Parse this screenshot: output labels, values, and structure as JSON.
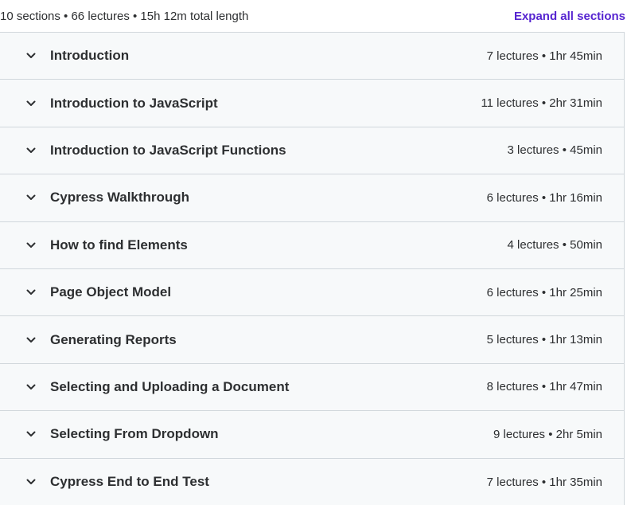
{
  "header": {
    "summary": "10 sections • 66 lectures • 15h 12m total length",
    "expand_label": "Expand all sections"
  },
  "colors": {
    "accent": "#5624d0",
    "section_bg": "#f7f9fa",
    "border": "#d1d7dc",
    "text": "#2d2f31"
  },
  "sections": [
    {
      "title": "Introduction",
      "meta": "7 lectures • 1hr 45min",
      "icon": "chevron-down-icon"
    },
    {
      "title": "Introduction to JavaScript",
      "meta": "11 lectures • 2hr 31min",
      "icon": "chevron-down-icon"
    },
    {
      "title": "Introduction to JavaScript Functions",
      "meta": "3 lectures • 45min",
      "icon": "chevron-down-icon"
    },
    {
      "title": "Cypress Walkthrough",
      "meta": "6 lectures • 1hr 16min",
      "icon": "chevron-down-icon"
    },
    {
      "title": "How to find Elements",
      "meta": "4 lectures • 50min",
      "icon": "chevron-down-icon"
    },
    {
      "title": "Page Object Model",
      "meta": "6 lectures • 1hr 25min",
      "icon": "chevron-down-icon"
    },
    {
      "title": "Generating Reports",
      "meta": "5 lectures • 1hr 13min",
      "icon": "chevron-down-icon"
    },
    {
      "title": "Selecting and Uploading a Document",
      "meta": "8 lectures • 1hr 47min",
      "icon": "chevron-down-icon"
    },
    {
      "title": "Selecting From Dropdown",
      "meta": "9 lectures • 2hr 5min",
      "icon": "chevron-down-icon"
    },
    {
      "title": "Cypress End to End Test",
      "meta": "7 lectures • 1hr 35min",
      "icon": "chevron-down-icon"
    }
  ]
}
